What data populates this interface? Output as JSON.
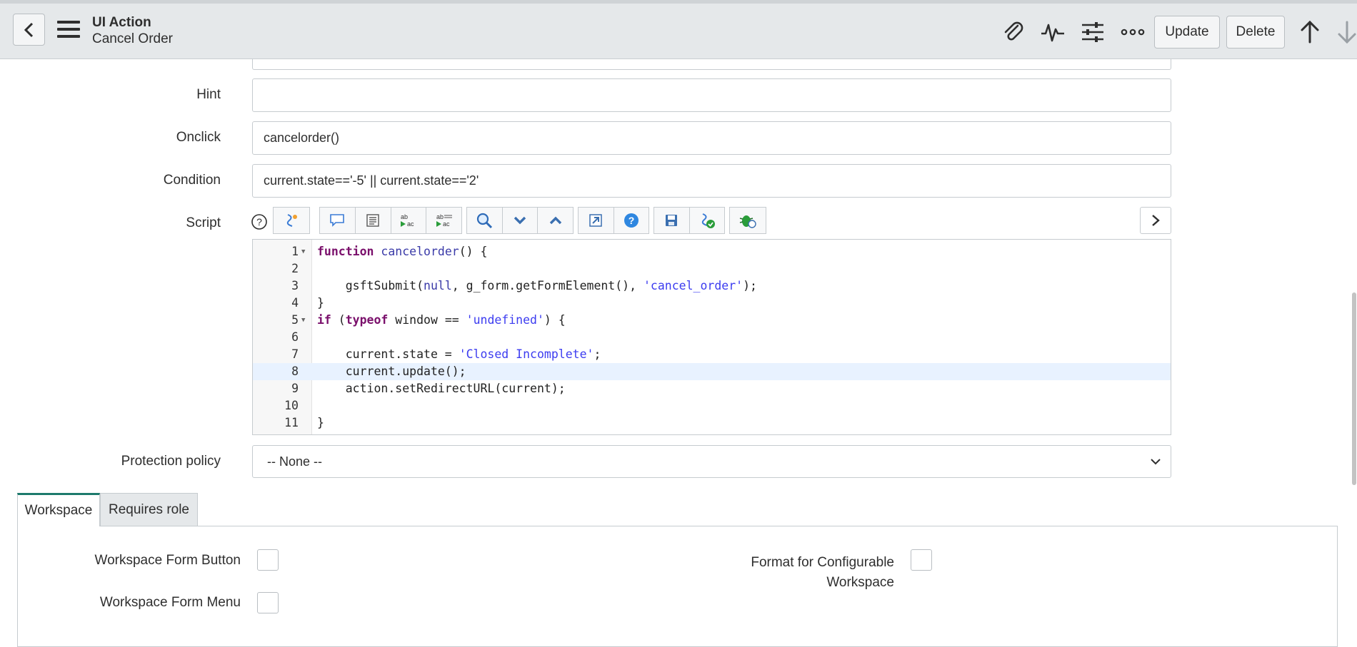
{
  "header": {
    "title": "UI Action",
    "subtitle": "Cancel Order",
    "update_label": "Update",
    "delete_label": "Delete",
    "icons": [
      "back-icon",
      "menu-icon",
      "paperclip-icon",
      "activity-icon",
      "settings-sliders-icon",
      "more-icon",
      "up-arrow-icon",
      "down-arrow-icon"
    ]
  },
  "form": {
    "hint_label": "Hint",
    "hint_value": "",
    "onclick_label": "Onclick",
    "onclick_value": "cancelorder()",
    "condition_label": "Condition",
    "condition_value": "current.state=='-5' || current.state=='2'",
    "script_label": "Script",
    "protection_label": "Protection policy",
    "protection_value": "-- None --"
  },
  "script": {
    "line_numbers": [
      "1",
      "2",
      "3",
      "4",
      "5",
      "6",
      "7",
      "8",
      "9",
      "10",
      "11"
    ],
    "active_line": 8,
    "toolbar_icons": [
      "help-icon",
      "format-code-icon",
      "comment-icon",
      "document-icon",
      "replace-icon",
      "replace-all-icon",
      "search-icon",
      "fold-down-icon",
      "fold-up-icon",
      "fullscreen-icon",
      "help-circle-icon",
      "save-icon",
      "syntax-check-icon",
      "debug-icon",
      "expand-icon"
    ]
  },
  "tabs": {
    "workspace": "Workspace",
    "requires_role": "Requires role"
  },
  "workspace": {
    "form_button_label": "Workspace Form Button",
    "form_menu_label": "Workspace Form Menu",
    "configurable_label_1": "Format for Configurable",
    "configurable_label_2": "Workspace"
  },
  "colors": {
    "header_bg": "#e5e8ea",
    "tab_accent": "#1d7a6c",
    "keyword": "#7a0f6b",
    "string": "#3c3cf0",
    "active_line_bg": "#e8f2ff"
  }
}
